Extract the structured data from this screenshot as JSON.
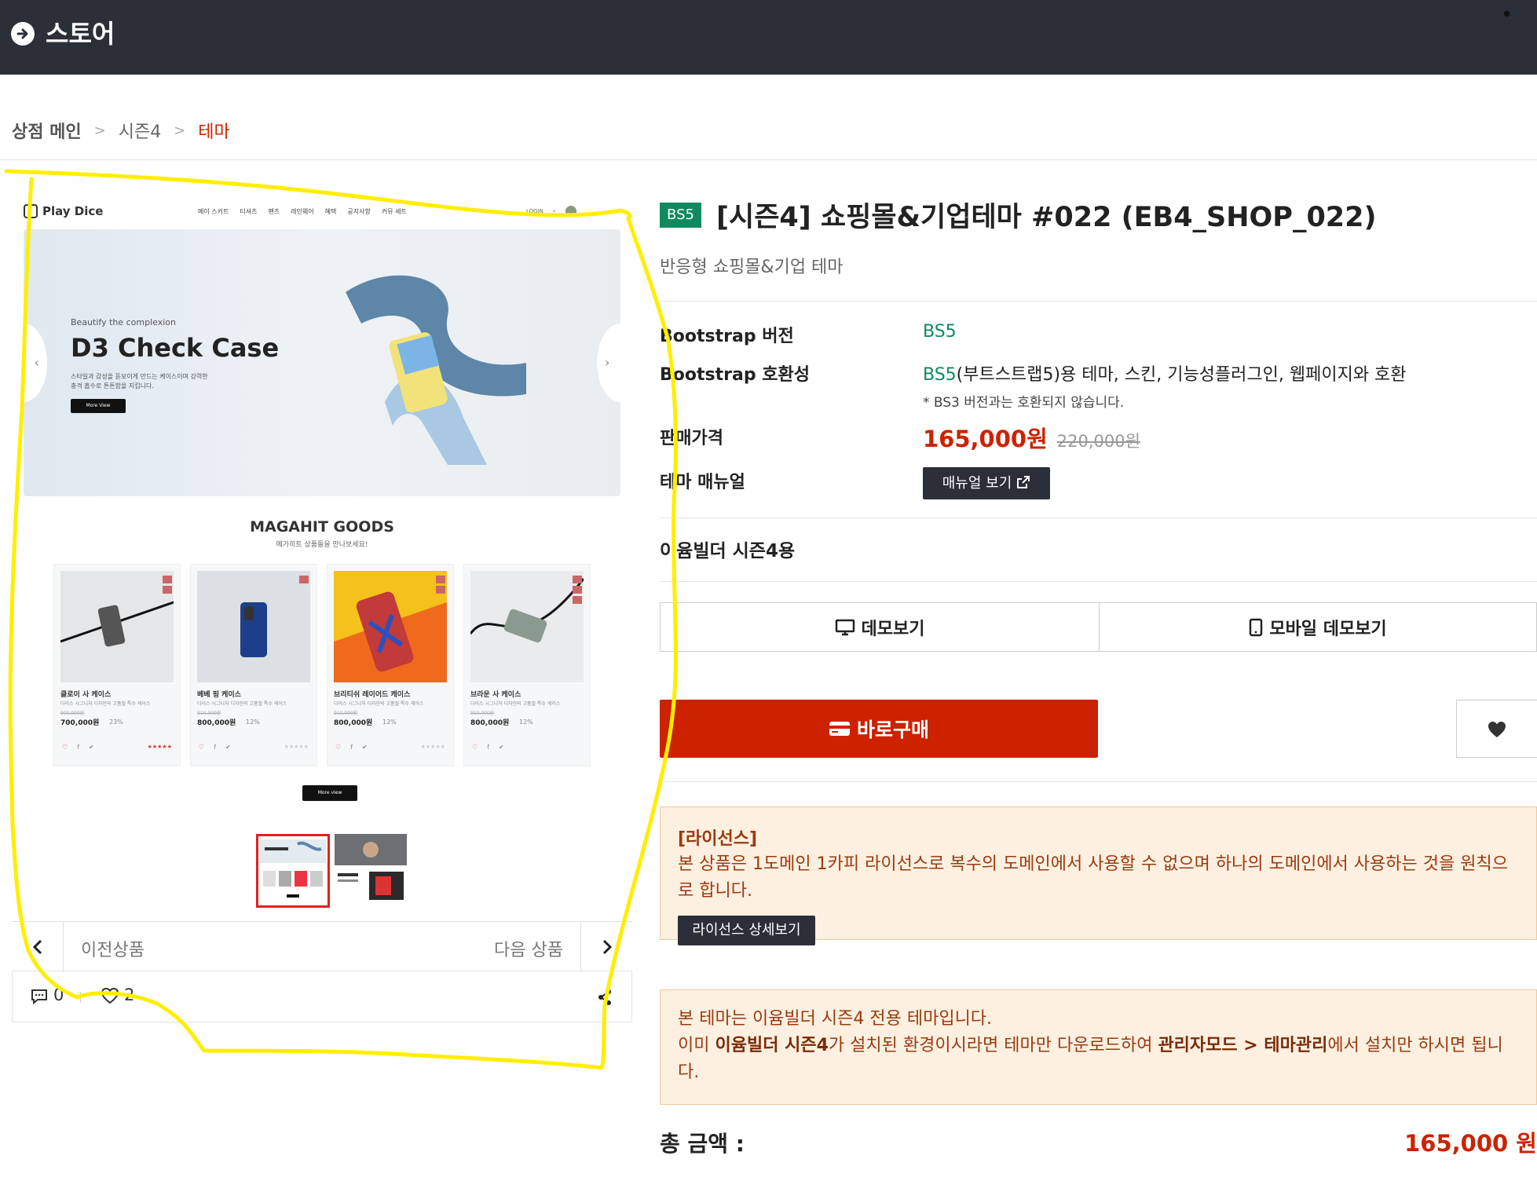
{
  "header": {
    "title": "스토어"
  },
  "breadcrumb": {
    "main": "상점 메인",
    "sep": ">",
    "season": "시즌4",
    "current": "테마"
  },
  "preview": {
    "logo": "Play Dice",
    "nav": [
      "메이 스커트",
      "티셔츠",
      "팬츠",
      "레인웨어",
      "혜택",
      "공지사항",
      "커뮤 세트"
    ],
    "nav_login": "LOGIN",
    "hero_sub": "Beautify the complexion",
    "hero_title": "D3 Check Case",
    "hero_desc": "스타일과 감성을 돋보이게 만드는 케이스이며 강력한 충격 흡수로 튼튼함을 지킵니다.",
    "hero_button": "More View",
    "goods_title": "MAGAHIT GOODS",
    "goods_sub": "메가히트 상품들을 만나보세요!",
    "products": [
      {
        "name": "클로이 사 케이스",
        "desc": "다이스 시그니처 디자인의 고품질 특수 케이스",
        "old": "900,000원",
        "price": "700,000원",
        "disc": "23%"
      },
      {
        "name": "베베 핑 케이스",
        "desc": "다이스 시그니처 디자인의 고품질 특수 케이스",
        "old": "910,000원",
        "price": "800,000원",
        "disc": "12%"
      },
      {
        "name": "브리티쉬 레이어드 케이스",
        "desc": "다이스 시그니처 디자인의 고품질 특수 케이스",
        "old": "910,000원",
        "price": "800,000원",
        "disc": "12%"
      },
      {
        "name": "브라운 사 케이스",
        "desc": "다이스 시그니처 디자인의 고품질 특수 케이스",
        "old": "910,000원",
        "price": "800,000원",
        "disc": "12%"
      }
    ],
    "more_button": "More view",
    "prev_label": "이전상품",
    "next_label": "다음 상품",
    "comment_count": "0",
    "like_count": "2"
  },
  "product": {
    "badge": "BS5",
    "title": "[시즌4] 쇼핑몰&기업테마 #022 (EB4_SHOP_022)",
    "subtitle": "반응형 쇼핑몰&기업 테마",
    "bs_version_label": "Bootstrap 버전",
    "bs_version_value": "BS5",
    "compat_label": "Bootstrap 호환성",
    "compat_value_prefix": "BS5",
    "compat_value_rest": "(부트스트랩5)용 테마, 스킨, 기능성플러그인, 웹페이지와 호환",
    "compat_note": "* BS3 버전과는 호환되지 않습니다.",
    "price_label": "판매가격",
    "price": "165,000원",
    "old_price": "220,000원",
    "manual_label": "테마 매뉴얼",
    "manual_button": "매뉴얼 보기",
    "season_line": "이윰빌더 시즌4용",
    "demo_button": "데모보기",
    "mobile_demo_button": "모바일 데모보기",
    "buy_button": "바로구매",
    "license_title": "[라이선스]",
    "license_body": "본 상품은 1도메인 1카피 라이선스로 복수의 도메인에서 사용할 수 없으며 하나의 도메인에서 사용하는 것을 원칙으로 합니다.",
    "license_button": "라이선스 상세보기",
    "notice_line1": "본 테마는 이윰빌더 시즌4 전용 테마입니다.",
    "notice_a": "이미 ",
    "notice_b": "이윰빌더 시즌4",
    "notice_c": "가 설치된 환경이시라면 테마만 다운로드하여 ",
    "notice_d": "관리자모드 > 테마관리",
    "notice_e": "에서 설치만 하시면 됩니다.",
    "total_label": "총 금액 :",
    "total_value": "165,000 원"
  },
  "colors": {
    "header_bg": "#2b2f38",
    "accent_red": "#cc2200",
    "bs_green": "#0f8a5f",
    "annotation_yellow": "#ffee00",
    "notice_bg": "#fdf0e0"
  },
  "icons": [
    "arrow-right-circle-icon",
    "chevron-left-icon",
    "chevron-right-icon",
    "comment-icon",
    "heart-outline-icon",
    "share-icon",
    "external-link-icon",
    "monitor-icon",
    "mobile-icon",
    "card-icon",
    "heart-icon"
  ]
}
